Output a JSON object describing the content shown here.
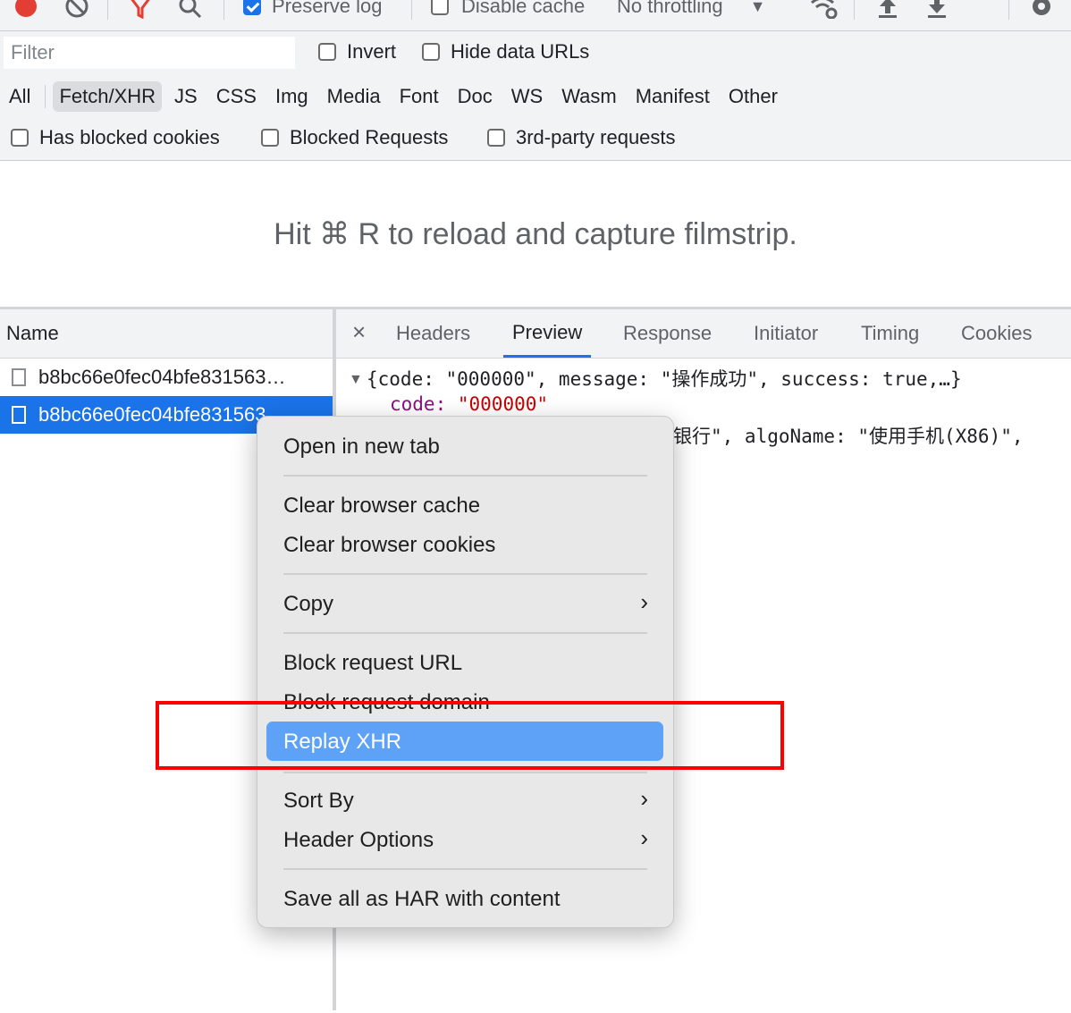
{
  "toolbar": {
    "preserve_log_label": "Preserve log",
    "preserve_log_checked": true,
    "disable_cache_label": "Disable cache",
    "disable_cache_checked": false,
    "throttling_label": "No throttling"
  },
  "filter": {
    "placeholder": "Filter",
    "invert_label": "Invert",
    "hide_data_urls_label": "Hide data URLs",
    "types": [
      "All",
      "Fetch/XHR",
      "JS",
      "CSS",
      "Img",
      "Media",
      "Font",
      "Doc",
      "WS",
      "Wasm",
      "Manifest",
      "Other"
    ],
    "active_type": "Fetch/XHR",
    "has_blocked_cookies_label": "Has blocked cookies",
    "blocked_requests_label": "Blocked Requests",
    "third_party_label": "3rd-party requests"
  },
  "filmstrip_hint": "Hit ⌘ R to reload and capture filmstrip.",
  "requests": {
    "column_header": "Name",
    "rows": [
      {
        "name": "b8bc66e0fec04bfe831563…"
      },
      {
        "name": "b8bc66e0fec04bfe831563…"
      }
    ]
  },
  "detail": {
    "close_glyph": "×",
    "tabs": [
      "Headers",
      "Preview",
      "Response",
      "Initiator",
      "Timing",
      "Cookies"
    ],
    "active_tab": "Preview",
    "preview": {
      "line1": "{code: \"000000\", message: \"操作成功\", success: true,…}",
      "code_key": "code:",
      "code_value": "\"000000\"",
      "line3": "银行\", algoName: \"使用手机(X86)\","
    }
  },
  "context_menu": {
    "open_new_tab": "Open in new tab",
    "clear_cache": "Clear browser cache",
    "clear_cookies": "Clear browser cookies",
    "copy": "Copy",
    "block_url": "Block request URL",
    "block_domain": "Block request domain",
    "replay_xhr": "Replay XHR",
    "sort_by": "Sort By",
    "header_options": "Header Options",
    "save_har": "Save all as HAR with content",
    "submenu_glyph": "›"
  },
  "colors": {
    "selection_blue": "#1a73e8",
    "menu_highlight": "#5ea2f7",
    "annotation_red": "#ff0000",
    "record_red": "#e33e33"
  }
}
